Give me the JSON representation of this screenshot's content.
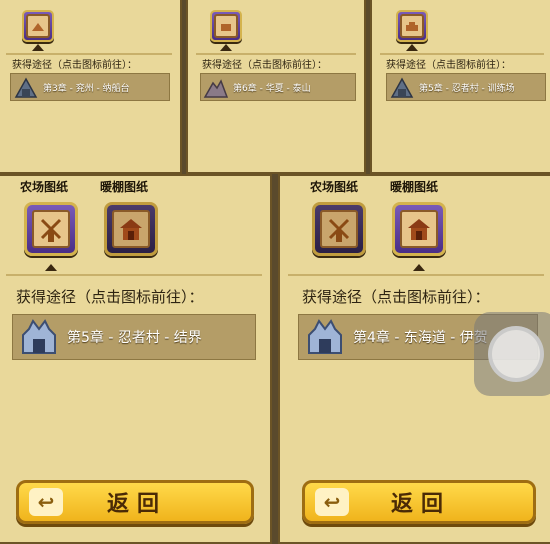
{
  "top_panels": [
    {
      "route_label": "获得途径（点击图标前往）：",
      "route": "第3章 - 兖州 - 纳船台",
      "icon": "scroll-map-icon"
    },
    {
      "route_label": "获得途径（点击图标前往）：",
      "route": "第6章 - 华夏 - 泰山",
      "icon": "scroll-map-icon"
    },
    {
      "route_label": "获得途径（点击图标前往）：",
      "route": "第5章 - 忍者村 - 训练场",
      "icon": "scroll-map-icon"
    }
  ],
  "bottom_panels": [
    {
      "items": [
        {
          "label": "农场图纸",
          "icon": "windmill-scroll-icon",
          "selected": true
        },
        {
          "label": "暖棚图纸",
          "icon": "house-scroll-icon",
          "selected": false
        }
      ],
      "route_label": "获得途径（点击图标前往）：",
      "route": "第5章 - 忍者村 - 结界",
      "return_label": "返回"
    },
    {
      "items": [
        {
          "label": "农场图纸",
          "icon": "windmill-scroll-icon",
          "selected": false
        },
        {
          "label": "暖棚图纸",
          "icon": "house-scroll-icon",
          "selected": true
        }
      ],
      "route_label": "获得途径（点击图标前往）：",
      "route": "第4章 - 东海道 - 伊贺",
      "return_label": "返回"
    }
  ],
  "colors": {
    "panel": "#e9d89a",
    "button": "#f0b41c",
    "route_bar": "#b49d67"
  }
}
